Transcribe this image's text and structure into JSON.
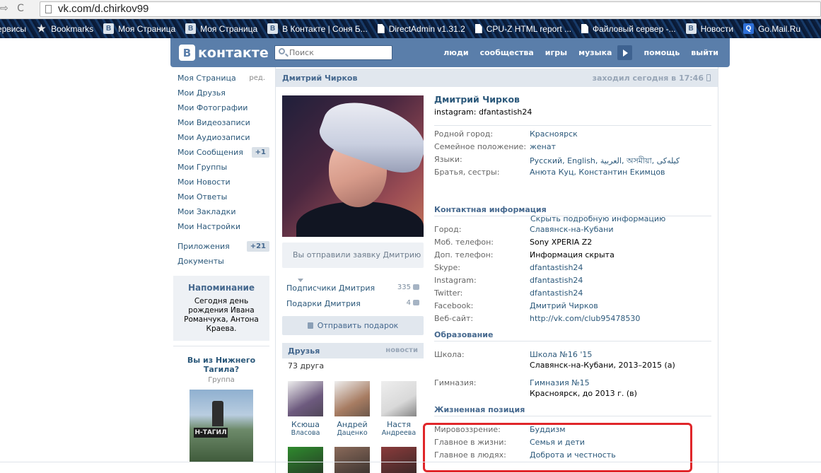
{
  "browser": {
    "nav_glyphs": "⇨ C",
    "url": "vk.com/d.chirkov99",
    "bookmarks": [
      {
        "label": "ервисы",
        "icon": "none"
      },
      {
        "label": "Bookmarks",
        "icon": "star-icon"
      },
      {
        "label": "Моя Страница",
        "icon": "vk-icon"
      },
      {
        "label": "Моя Страница",
        "icon": "vk-icon"
      },
      {
        "label": "В Контакте | Соня Б...",
        "icon": "vk-icon"
      },
      {
        "label": "DirectAdmin v1.31.2",
        "icon": "document-icon"
      },
      {
        "label": "CPU-Z HTML report ...",
        "icon": "document-icon"
      },
      {
        "label": "Файловый сервер -...",
        "icon": "document-icon"
      },
      {
        "label": "Новости",
        "icon": "vk-icon"
      },
      {
        "label": "Go.Mail.Ru",
        "icon": "mail-icon"
      }
    ]
  },
  "header": {
    "logo_mark": "В",
    "logo_text": "контакте",
    "search_placeholder": "Поиск",
    "nav": [
      "люди",
      "сообщества",
      "игры",
      "музыка"
    ],
    "nav_after": [
      "помощь",
      "выйти"
    ]
  },
  "left_menu": {
    "items": [
      {
        "label": "Моя Страница",
        "aux": "ред."
      },
      {
        "label": "Мои Друзья"
      },
      {
        "label": "Мои Фотографии"
      },
      {
        "label": "Мои Видеозаписи"
      },
      {
        "label": "Мои Аудиозаписи"
      },
      {
        "label": "Мои Сообщения",
        "count": "+1"
      },
      {
        "label": "Мои Группы"
      },
      {
        "label": "Мои Новости"
      },
      {
        "label": "Мои Ответы"
      },
      {
        "label": "Мои Закладки"
      },
      {
        "label": "Мои Настройки"
      }
    ],
    "items2": [
      {
        "label": "Приложения",
        "count": "+21"
      },
      {
        "label": "Документы"
      }
    ],
    "reminder": {
      "title": "Напоминание",
      "text": "Сегодня день рождения Ивана Романчука, Антона Краева."
    },
    "ad": {
      "title": "Вы из Нижнего Тагила?",
      "subtitle": "Группа",
      "image_text": "Н-ТАГИЛ"
    }
  },
  "profile": {
    "header_name": "Дмитрий Чирков",
    "last_seen": "заходил сегодня в 17:46",
    "request_button": "Вы отправили заявку Дмитрию",
    "subscribers": {
      "label": "Подписчики Дмитрия",
      "count": "335"
    },
    "gifts": {
      "label": "Подарки Дмитрия",
      "count": "4"
    },
    "send_gift": "Отправить подарок",
    "friends": {
      "title": "Друзья",
      "news": "новости",
      "count": "73 друга",
      "list": [
        {
          "first": "Ксюша",
          "last": "Власова",
          "color": "#6d5a7e"
        },
        {
          "first": "Андрей",
          "last": "Даценко",
          "color": "#a77c62"
        },
        {
          "first": "Настя",
          "last": "Андреева",
          "color": "#d9d9d9"
        }
      ],
      "row2_colors": [
        "#2f8a2e",
        "#8a6a5a",
        "#8a3b3b"
      ]
    },
    "name": "Дмитрий Чирков",
    "status": "instagram: dfantastish24",
    "basic": [
      {
        "k": "Родной город:",
        "v": "Красноярск",
        "link": true
      },
      {
        "k": "Семейное положение:",
        "v": "женат",
        "link": true
      },
      {
        "k": "Языки:",
        "v": "Русский, English, العربية, অসমীয়া, کیلەکی",
        "link": true
      },
      {
        "k": "Братья, сестры:",
        "v": "Анюта Куц, Константин Екимцов",
        "link": true
      }
    ],
    "hide_link": "Скрыть подробную информацию",
    "contacts_title": "Контактная информация",
    "contacts": [
      {
        "k": "Город:",
        "v": "Славянск-на-Кубани",
        "link": true
      },
      {
        "k": "Моб. телефон:",
        "v": "Sony XPERIA Z2",
        "link": false
      },
      {
        "k": "Доп. телефон:",
        "v": "Информация скрыта",
        "link": false
      },
      {
        "k": "Skype:",
        "v": "dfantastish24",
        "link": true
      },
      {
        "k": "Instagram:",
        "v": "dfantastish24",
        "link": true
      },
      {
        "k": "Twitter:",
        "v": "dfantastish24",
        "link": true
      },
      {
        "k": "Facebook:",
        "v": "Дмитрий Чирков",
        "link": true
      },
      {
        "k": "Веб-сайт:",
        "v": "http://vk.com/club95478530",
        "link": true
      }
    ],
    "education_title": "Образование",
    "school": {
      "k": "Школа:",
      "v1": "Школа №16 '15",
      "v2": "Славянск-на-Кубани, 2013–2015 (а)"
    },
    "gymnasium": {
      "k": "Гимназия:",
      "v1": "Гимназия №15",
      "v2": "Красноярск, до 2013 г. (в)"
    },
    "life_title": "Жизненная позиция",
    "life": [
      {
        "k": "Мировоззрение:",
        "v": "Буддизм"
      },
      {
        "k": "Главное в жизни:",
        "v": "Семья и дети"
      },
      {
        "k": "Главное в людях:",
        "v": "Доброта и честность"
      }
    ]
  },
  "colors": {
    "vk_blue": "#5a7eaa",
    "link": "#2b587a",
    "highlight_red": "#e0262a"
  }
}
